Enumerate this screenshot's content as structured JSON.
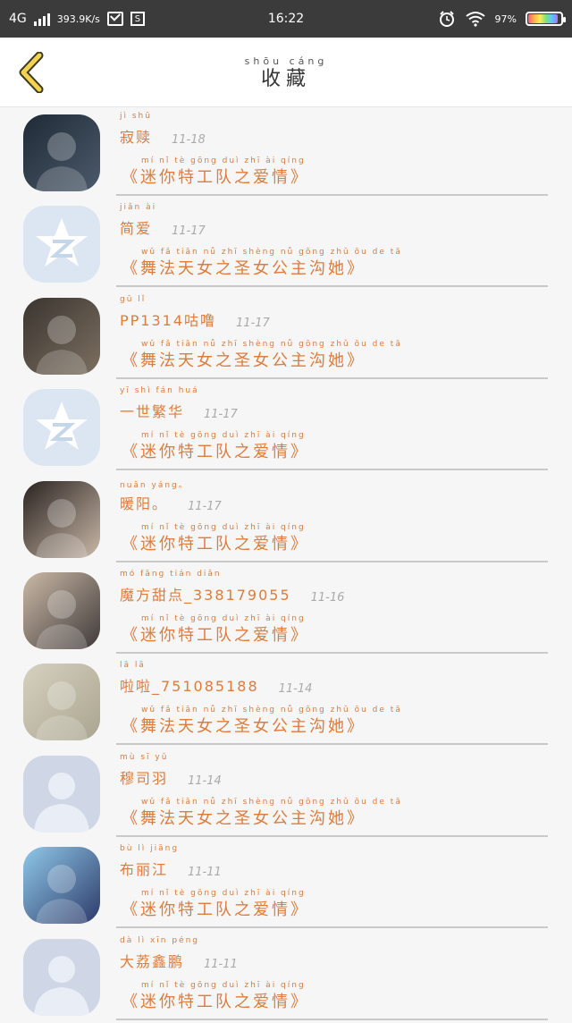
{
  "status_bar": {
    "network": "4G",
    "speed": "393.9K/s",
    "time": "16:22",
    "battery": "97%"
  },
  "nav": {
    "title_pinyin": "shōu cáng",
    "title": "收藏"
  },
  "items": [
    {
      "pinyin": "jì shū",
      "name": "寂赎",
      "date": "11-18",
      "msg_pinyin": "mí nǐ tè gōng duì zhī ài qíng",
      "msg": "《迷你特工队之爱情》",
      "avatar": "photo"
    },
    {
      "pinyin": "jiǎn ài",
      "name": "简爱",
      "date": "11-17",
      "msg_pinyin": "wǔ fǎ tiān nǚ zhī shèng nǚ gōng zhǔ ōu de tā",
      "msg": "《舞法天女之圣女公主沟她》",
      "avatar": "qq"
    },
    {
      "pinyin": "gū lǐ",
      "name": "PP1314咕噜",
      "date": "11-17",
      "msg_pinyin": "wǔ fǎ tiān nǚ zhī shèng nǚ gōng zhǔ ōu de tā",
      "msg": "《舞法天女之圣女公主沟她》",
      "avatar": "photo"
    },
    {
      "pinyin": "yī shì fán huá",
      "name": "一世繁华",
      "date": "11-17",
      "msg_pinyin": "mí nǐ tè gōng duì zhī ài qíng",
      "msg": "《迷你特工队之爱情》",
      "avatar": "qq"
    },
    {
      "pinyin": "nuǎn yáng。",
      "name": "暖阳。",
      "date": "11-17",
      "msg_pinyin": "mí nǐ tè gōng duì zhī ài qíng",
      "msg": "《迷你特工队之爱情》",
      "avatar": "photo"
    },
    {
      "pinyin": "mó fāng tián diǎn",
      "name": "魔方甜点_338179055",
      "date": "11-16",
      "msg_pinyin": "mí nǐ tè gōng duì zhī ài qíng",
      "msg": "《迷你特工队之爱情》",
      "avatar": "photo"
    },
    {
      "pinyin": "lā lā",
      "name": "啦啦_751085188",
      "date": "11-14",
      "msg_pinyin": "wǔ fǎ tiān nǚ zhī shèng nǚ gōng zhǔ ōu de tā",
      "msg": "《舞法天女之圣女公主沟她》",
      "avatar": "photo"
    },
    {
      "pinyin": "mù sī yǔ",
      "name": "穆司羽",
      "date": "11-14",
      "msg_pinyin": "wǔ fǎ tiān nǚ zhī shèng nǚ gōng zhǔ ōu de tā",
      "msg": "《舞法天女之圣女公主沟她》",
      "avatar": "default"
    },
    {
      "pinyin": "bù lì jiāng",
      "name": "布丽江",
      "date": "11-11",
      "msg_pinyin": "mí nǐ tè gōng duì zhī ài qíng",
      "msg": "《迷你特工队之爱情》",
      "avatar": "photo"
    },
    {
      "pinyin": "dà lì xīn péng",
      "name": "大荔鑫鹏",
      "date": "11-11",
      "msg_pinyin": "mí nǐ tè gōng duì zhī ài qíng",
      "msg": "《迷你特工队之爱情》",
      "avatar": "default"
    }
  ]
}
